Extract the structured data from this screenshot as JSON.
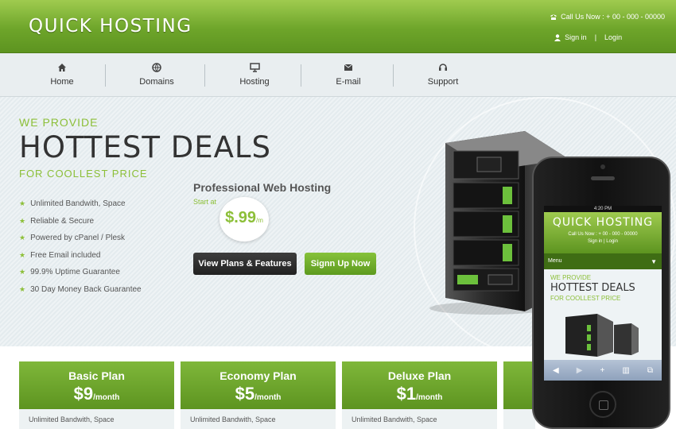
{
  "header": {
    "logo": "QUICK HOSTING",
    "call": "Call Us Now : + 00 - 000 - 00000",
    "signin": "Sign in",
    "login": "Login"
  },
  "nav": [
    {
      "label": "Home",
      "icon": "home-icon"
    },
    {
      "label": "Domains",
      "icon": "globe-icon"
    },
    {
      "label": "Hosting",
      "icon": "monitor-icon"
    },
    {
      "label": "E-mail",
      "icon": "mail-icon"
    },
    {
      "label": "Support",
      "icon": "headset-icon"
    }
  ],
  "hero": {
    "we_provide": "WE PROVIDE",
    "headline": "HOTTEST DEALS",
    "subline": "FOR COOLLEST PRICE",
    "features": [
      "Unlimited Bandwith, Space",
      "Reliable & Secure",
      "Powered by cPanel / Plesk",
      "Free Email included",
      "99.9% Uptime Guarantee",
      "30 Day Money Back Guarantee"
    ],
    "product": "Professional Web Hosting",
    "start_at": "Start at",
    "price": "$.99",
    "per": "/m",
    "btn_plans": "View Plans & Features",
    "btn_signup": "Signn Up Now"
  },
  "plans": [
    {
      "name": "Basic Plan",
      "price": "$9",
      "per": "/month",
      "feature": "Unlimited Bandwith, Space"
    },
    {
      "name": "Economy Plan",
      "price": "$5",
      "per": "/month",
      "feature": "Unlimited Bandwith, Space"
    },
    {
      "name": "Deluxe Plan",
      "price": "$1",
      "per": "/month",
      "feature": "Unlimited Bandwith, Space"
    }
  ],
  "phone": {
    "time": "4:20 PM",
    "logo": "QUICK HOSTING",
    "call": "Call Us Now : + 00 - 000 - 00000",
    "signin": "Sign in",
    "login": "Login",
    "menu": "Menu",
    "we_provide": "WE PROVIDE",
    "headline": "HOTTEST DEALS",
    "subline": "FOR COOLLEST PRICE"
  },
  "colors": {
    "accent": "#8cbf38",
    "header": "#6ea52a",
    "dark": "#333333"
  }
}
